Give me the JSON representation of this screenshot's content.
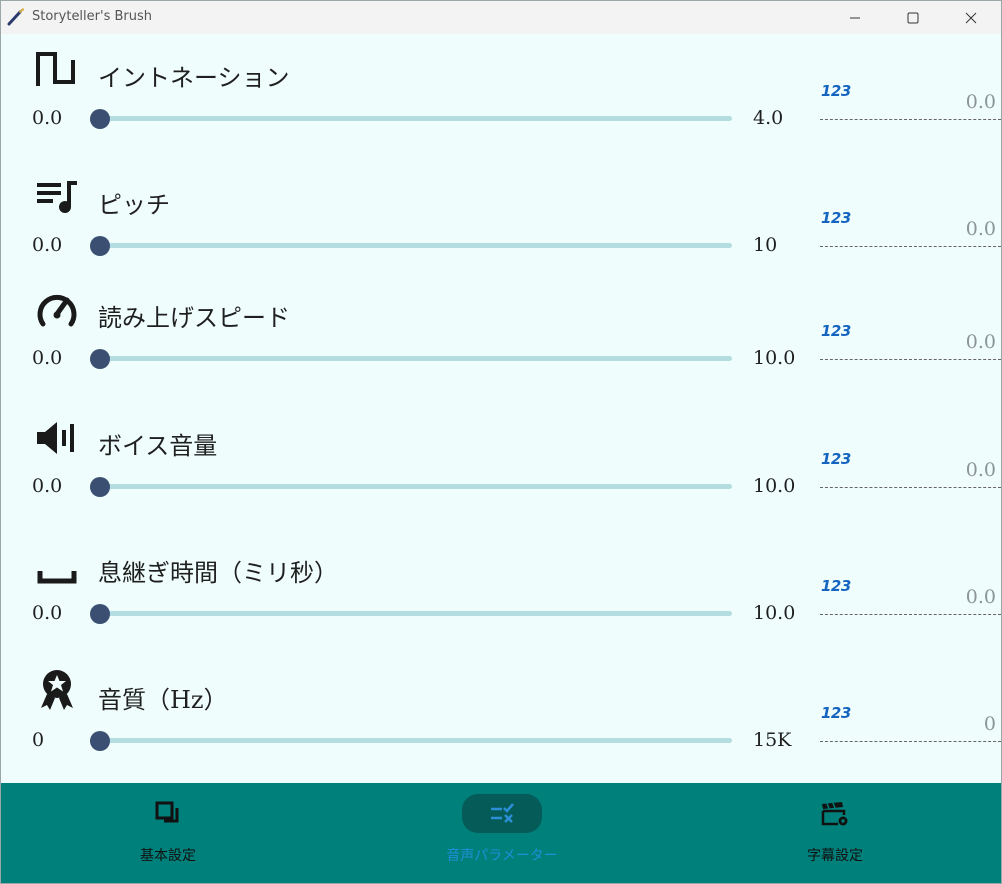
{
  "window": {
    "title": "Storyteller's Brush"
  },
  "params": [
    {
      "label": "イントネーション",
      "icon": "square-wave-icon",
      "min": "0.0",
      "max": "4.0",
      "value": "0.0",
      "slider_fraction": 0.0
    },
    {
      "label": "ピッチ",
      "icon": "music-list-icon",
      "min": "0.0",
      "max": "10",
      "value": "0.0",
      "slider_fraction": 0.0
    },
    {
      "label": "読み上げスピード",
      "icon": "speedometer-icon",
      "min": "0.0",
      "max": "10.0",
      "value": "0.0",
      "slider_fraction": 0.0
    },
    {
      "label": "ボイス音量",
      "icon": "volume-icon",
      "min": "0.0",
      "max": "10.0",
      "value": "0.0",
      "slider_fraction": 0.0
    },
    {
      "label": "息継ぎ時間（ミリ秒）",
      "icon": "space-bar-icon",
      "min": "0.0",
      "max": "10.0",
      "value": "0.0",
      "slider_fraction": 0.0
    },
    {
      "label": "音質（Hz）",
      "icon": "award-ribbon-icon",
      "min": "0",
      "max": "15K",
      "value": "0",
      "slider_fraction": 0.0
    }
  ],
  "numeric_icon_text": "123",
  "nav": {
    "items": [
      {
        "label": "基本設定",
        "icon": "copy-squares-icon",
        "active": false
      },
      {
        "label": "音声パラメーター",
        "icon": "checklist-icon",
        "active": true
      },
      {
        "label": "字幕設定",
        "icon": "clapperboard-settings-icon",
        "active": false
      }
    ]
  },
  "colors": {
    "background": "#effefc",
    "slider_track": "#b3dde0",
    "slider_thumb": "#3b4f72",
    "nav_background": "#00807a",
    "nav_active_pill": "#045b58",
    "nav_active_label": "#1f8ed9",
    "numeric_icon": "#1565c0"
  }
}
